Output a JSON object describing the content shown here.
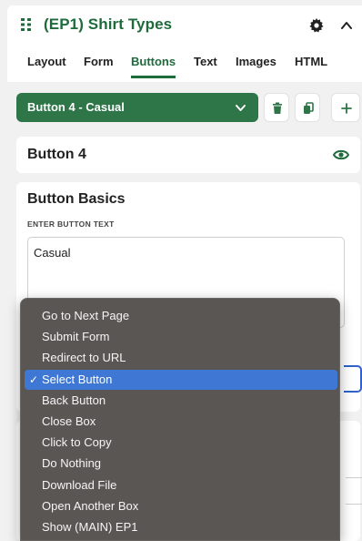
{
  "header": {
    "title": "(EP1) Shirt Types",
    "tabs": [
      {
        "label": "Layout",
        "active": false
      },
      {
        "label": "Form",
        "active": false
      },
      {
        "label": "Buttons",
        "active": true
      },
      {
        "label": "Text",
        "active": false
      },
      {
        "label": "Images",
        "active": false
      },
      {
        "label": "HTML",
        "active": false
      }
    ]
  },
  "button_selector": {
    "selected": "Button 4 - Casual"
  },
  "button_card": {
    "title": "Button 4"
  },
  "button_basics": {
    "title": "Button Basics",
    "field_label": "ENTER BUTTON TEXT",
    "button_text": "Casual"
  },
  "action_menu": {
    "items": [
      "Go to Next Page",
      "Submit Form",
      "Redirect to URL",
      "Select Button",
      "Back Button",
      "Close Box",
      "Click to Copy",
      "Do Nothing",
      "Download File",
      "Open Another Box",
      "Show (MAIN) EP1"
    ],
    "selected": "Select Button",
    "checkmark": "✓"
  },
  "colors": {
    "brand_green": "#1e6b3b",
    "selector_green": "#2e7548",
    "menu_background": "#5a5654",
    "menu_highlight": "#3f78d4"
  }
}
